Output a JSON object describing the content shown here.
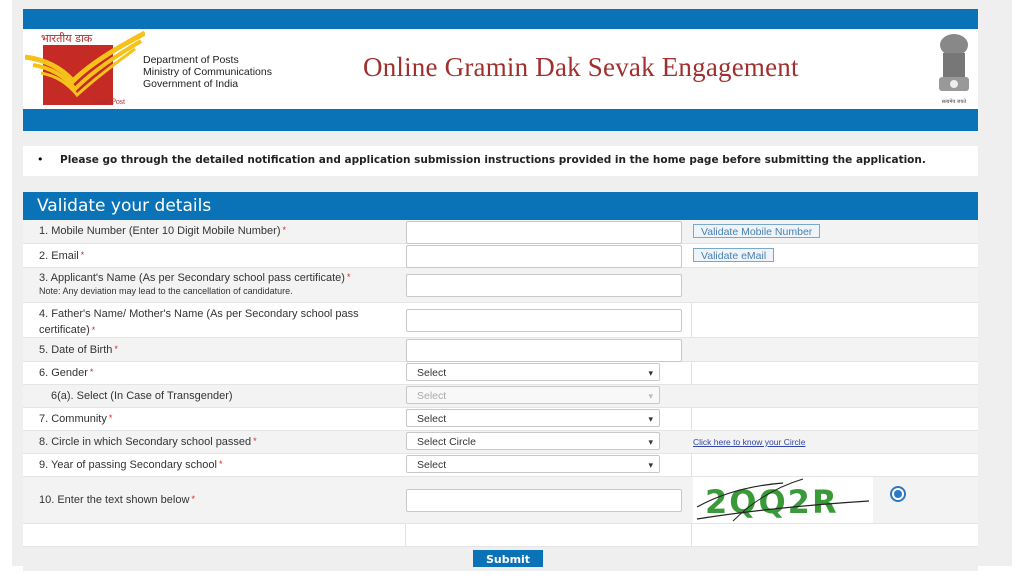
{
  "header": {
    "logo_hindi": "भारतीय डाक",
    "logo_caption": "India Post",
    "dept_lines": [
      "Department of Posts",
      "Ministry of Communications",
      "Government of India"
    ],
    "title": "Online Gramin Dak Sevak Engagement",
    "emblem_caption": "सत्यमेव जयते"
  },
  "notice": {
    "text": "Please go through the detailed notification and application submission instructions provided in the home page before submitting the application."
  },
  "form": {
    "heading": "Validate your details",
    "fields": [
      {
        "label": "1. Mobile Number (Enter 10 Digit Mobile Number)",
        "required": "*",
        "value": "",
        "action": "Validate Mobile Number"
      },
      {
        "label": "2. Email",
        "required": "*",
        "value": "",
        "action": "Validate eMail"
      },
      {
        "label": "3. Applicant's Name (As per Secondary school pass certificate)",
        "required": "*",
        "note": "Note: Any deviation may lead to the cancellation of candidature.",
        "value": ""
      },
      {
        "label": "4. Father's Name/ Mother's Name (As per Secondary school pass",
        "label2": "certificate)",
        "required": "*",
        "value": ""
      },
      {
        "label": "5. Date of Birth",
        "required": "*",
        "value": ""
      },
      {
        "label": "6. Gender",
        "required": "*",
        "selected": "Select"
      },
      {
        "label": "6(a). Select (In Case of Transgender)",
        "selected": "Select",
        "disabled": true
      },
      {
        "label": "7. Community",
        "required": "*",
        "selected": "Select"
      },
      {
        "label": "8. Circle in which Secondary school passed",
        "required": "*",
        "selected": "Select Circle",
        "link": "Click here to know your Circle"
      },
      {
        "label": "9. Year of passing Secondary school",
        "required": "*",
        "selected": "Select"
      },
      {
        "label": "10. Enter the text shown below",
        "required": "*",
        "value": "",
        "captcha_text": "2QQ2R"
      }
    ],
    "submit_label": "Submit"
  },
  "colors": {
    "brand_blue": "#0a73b7",
    "title_red": "#a0302e",
    "required_red": "#d9262a",
    "captcha_green": "#3a9a3a"
  }
}
